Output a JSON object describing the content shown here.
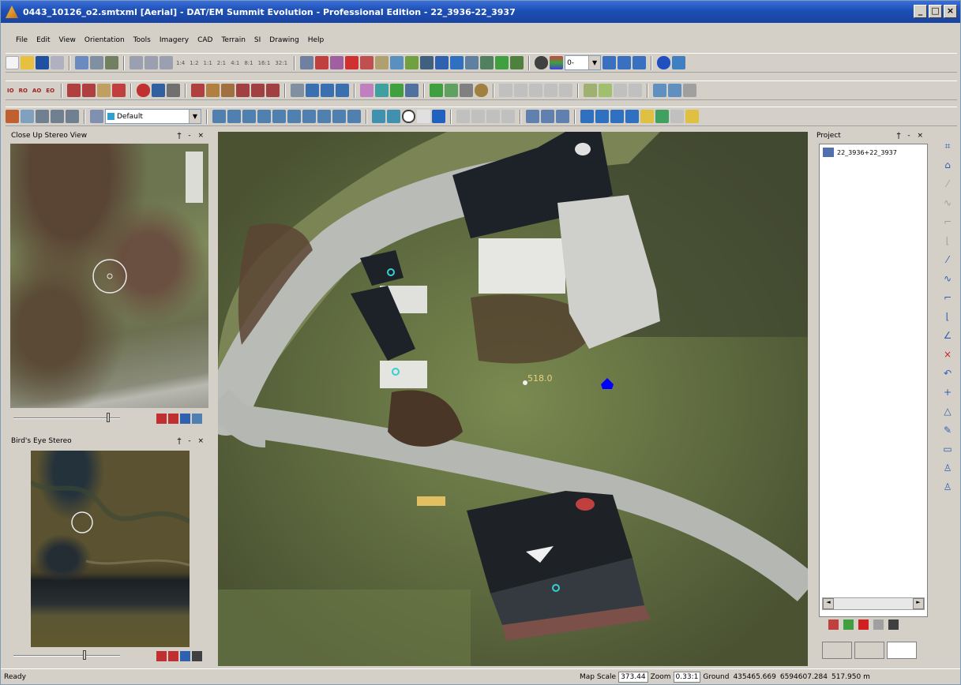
{
  "window": {
    "title": "0443_10126_o2.smtxml [Aerial] - DAT/EM Summit Evolution - Professional Edition - 22_3936-22_3937",
    "minimize_label": "_",
    "restore_label": "□",
    "close_label": "×"
  },
  "menu": [
    "File",
    "Edit",
    "View",
    "Orientation",
    "Tools",
    "Imagery",
    "CAD",
    "Terrain",
    "SI",
    "Drawing",
    "Help"
  ],
  "toolbar": {
    "zoom_ratios": [
      "1:4",
      "1:2",
      "1:1",
      "2:1",
      "4:1",
      "8:1",
      "16:1",
      "32:1"
    ],
    "orient_labels": [
      "IO",
      "RO",
      "AO",
      "EO"
    ],
    "layer_combo_value": "Default",
    "zoom_combo_value": "0-"
  },
  "panels": {
    "close_up": {
      "title": "Close Up Stereo View",
      "controls": "ϯ - ×"
    },
    "birds_eye": {
      "title": "Bird's Eye Stereo",
      "controls": "ϯ - ×"
    },
    "project": {
      "title": "Project",
      "controls": "ϯ - ×",
      "tree_item": "22_3936+22_3937"
    }
  },
  "main_view": {
    "elevation_label": "518.0"
  },
  "colors": {
    "title_bar": "#1d4fb5",
    "cursor_marker": "#0000ff",
    "point_marker": "#35d0d0"
  },
  "status": {
    "text": "Ready",
    "map_scale_label": "Map Scale",
    "map_scale_value": "373.44",
    "zoom_label": "Zoom",
    "zoom_value": "0.33:1",
    "ground_label": "Ground",
    "ground_x": "435465.669",
    "ground_y": "6594607.284",
    "ground_z": "517.950 m"
  }
}
